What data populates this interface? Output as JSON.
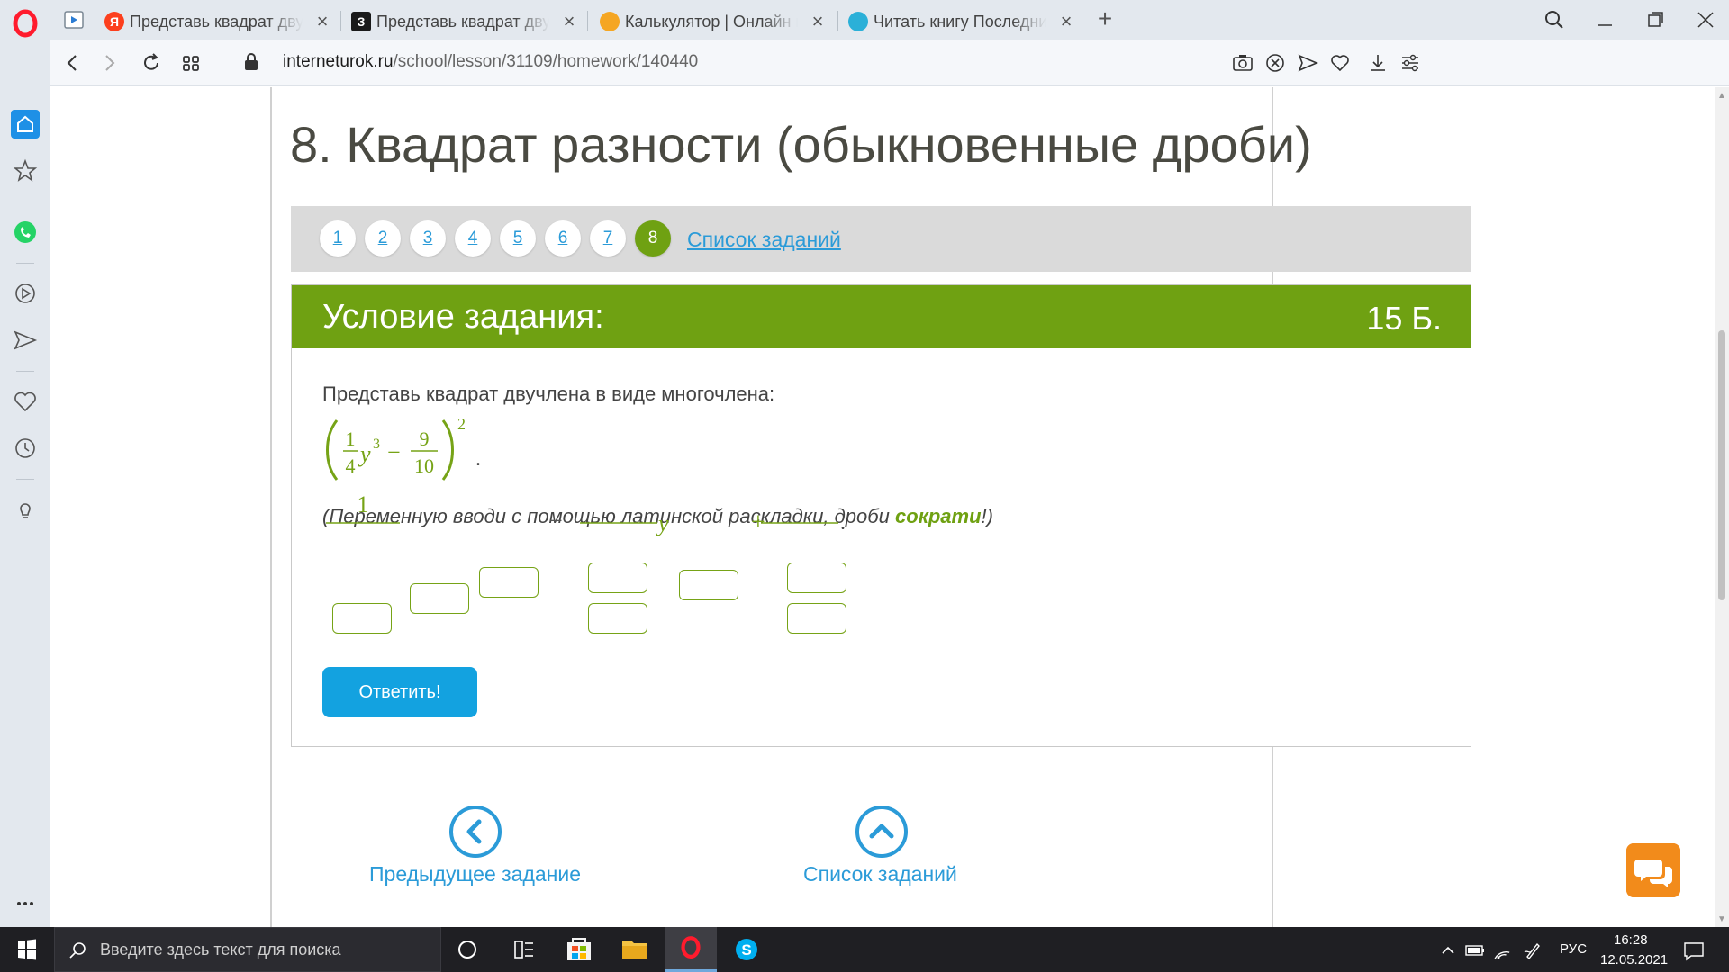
{
  "browser": {
    "tabs": [
      {
        "title": "Представь квадрат двучлена",
        "favicon_letter": "Я",
        "favicon_color": "#fc3f1d"
      },
      {
        "title": "Представь квадрат двучлена",
        "favicon_letter": "З",
        "favicon_color": "#1a1a1a"
      },
      {
        "title": "Калькулятор | Онлайн калькулятор",
        "favicon_letter": "",
        "favicon_color": "#f5a623"
      },
      {
        "title": "Читать книгу Последний",
        "favicon_letter": "",
        "favicon_color": "#2bb0d8"
      }
    ],
    "url_domain": "interneturok.ru",
    "url_path": "/school/lesson/31109/homework/140440"
  },
  "page": {
    "lesson_title": "8. Квадрат разности (обыкновенные дроби)",
    "task_numbers": [
      "1",
      "2",
      "3",
      "4",
      "5",
      "6",
      "7",
      "8"
    ],
    "active_task": "8",
    "task_list_link": "Список заданий",
    "condition_header": "Условие задания:",
    "points": "15 Б.",
    "task_text": "Представь квадрат двучлена в виде многочлена:",
    "expression": {
      "coef_num": "1",
      "coef_den": "4",
      "var": "y",
      "var_power": "3",
      "minus": "−",
      "frac2_num": "9",
      "frac2_den": "10",
      "outer_power": "2",
      "dot": "."
    },
    "hint_before": "(Переменную вводи с помощью латинской раскладки, дроби ",
    "hint_keyword": "сократи",
    "hint_after": "!)",
    "answer_template": {
      "first_num": "1",
      "minus": "−",
      "var": "y",
      "plus": "+",
      "dot": "."
    },
    "answer_button": "Ответить!",
    "prev_task_label": "Предыдущее задание",
    "task_list_label": "Список заданий"
  },
  "taskbar": {
    "search_placeholder": "Введите здесь текст для поиска",
    "lang": "РУС",
    "time": "16:28",
    "date": "12.05.2021"
  },
  "colors": {
    "accent_green": "#6fa112",
    "link_blue": "#2b9bd8",
    "button_blue": "#13a2e0",
    "chat_orange": "#f28b1b"
  }
}
